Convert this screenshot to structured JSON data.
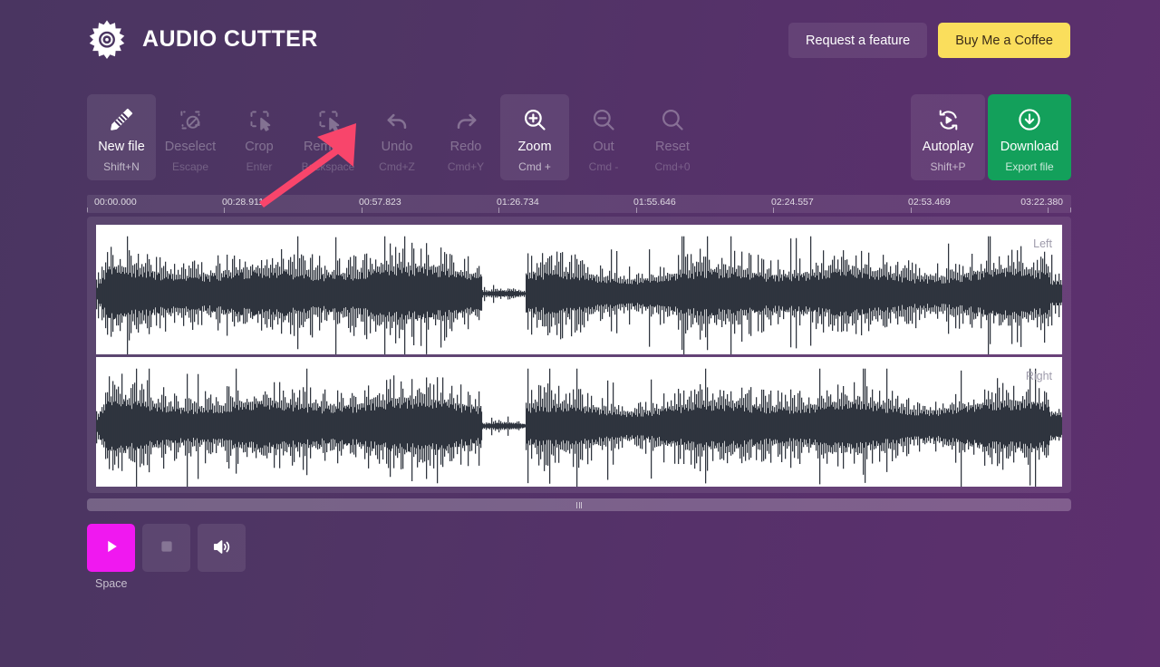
{
  "app": {
    "title": "AUDIO CUTTER",
    "logo_icon": "gear-eye-logo-icon",
    "bg_color_left": "#4a3561",
    "bg_color_right": "#5d2f6e"
  },
  "header": {
    "request_feature_label": "Request a feature",
    "buy_coffee_label": "Buy Me a Coffee",
    "coffee_color": "#fade5c"
  },
  "toolbar": {
    "items": [
      {
        "label": "New file",
        "shortcut": "Shift+N",
        "icon": "ruler-icon",
        "state": "active"
      },
      {
        "label": "Deselect",
        "shortcut": "Escape",
        "icon": "deselect-icon",
        "state": "disabled"
      },
      {
        "label": "Crop",
        "shortcut": "Enter",
        "icon": "crop-icon",
        "state": "disabled"
      },
      {
        "label": "Remove",
        "shortcut": "Backspace",
        "icon": "remove-selection-icon",
        "state": "disabled"
      },
      {
        "label": "Undo",
        "shortcut": "Cmd+Z",
        "icon": "undo-arrow-icon",
        "state": "disabled"
      },
      {
        "label": "Redo",
        "shortcut": "Cmd+Y",
        "icon": "redo-arrow-icon",
        "state": "disabled"
      },
      {
        "label": "Zoom",
        "shortcut": "Cmd +",
        "icon": "zoom-in-icon",
        "state": "active"
      },
      {
        "label": "Out",
        "shortcut": "Cmd -",
        "icon": "zoom-out-icon",
        "state": "disabled"
      },
      {
        "label": "Reset",
        "shortcut": "Cmd+0",
        "icon": "magnifier-icon",
        "state": "disabled"
      }
    ],
    "autoplay": {
      "label": "Autoplay",
      "shortcut": "Shift+P",
      "icon": "autoplay-loop-icon"
    },
    "download": {
      "label": "Download",
      "shortcut": "Export file",
      "icon": "download-circle-icon",
      "color": "#13a05b"
    }
  },
  "timeline": {
    "ticks": [
      "00:00.000",
      "00:28.911",
      "00:57.823",
      "01:26.734",
      "01:55.646",
      "02:24.557",
      "02:53.469",
      "03:22.380"
    ],
    "duration_label": "03:22.380"
  },
  "waveform": {
    "channels": [
      {
        "label": "Left",
        "waveform_color": "#2f343e"
      },
      {
        "label": "Right",
        "waveform_color": "#2f343e"
      }
    ],
    "background": "#ffffff"
  },
  "scrollbar": {
    "grip_icon": "drag-grip-icon"
  },
  "playback": {
    "play": {
      "icon": "play-icon",
      "color": "#f018f0"
    },
    "stop": {
      "icon": "stop-icon",
      "state": "disabled"
    },
    "volume": {
      "icon": "speaker-volume-icon"
    },
    "space_hint": "Space"
  },
  "annotation": {
    "arrow_color": "#f8456b",
    "arrow_icon": "pointer-arrow-annotation"
  }
}
